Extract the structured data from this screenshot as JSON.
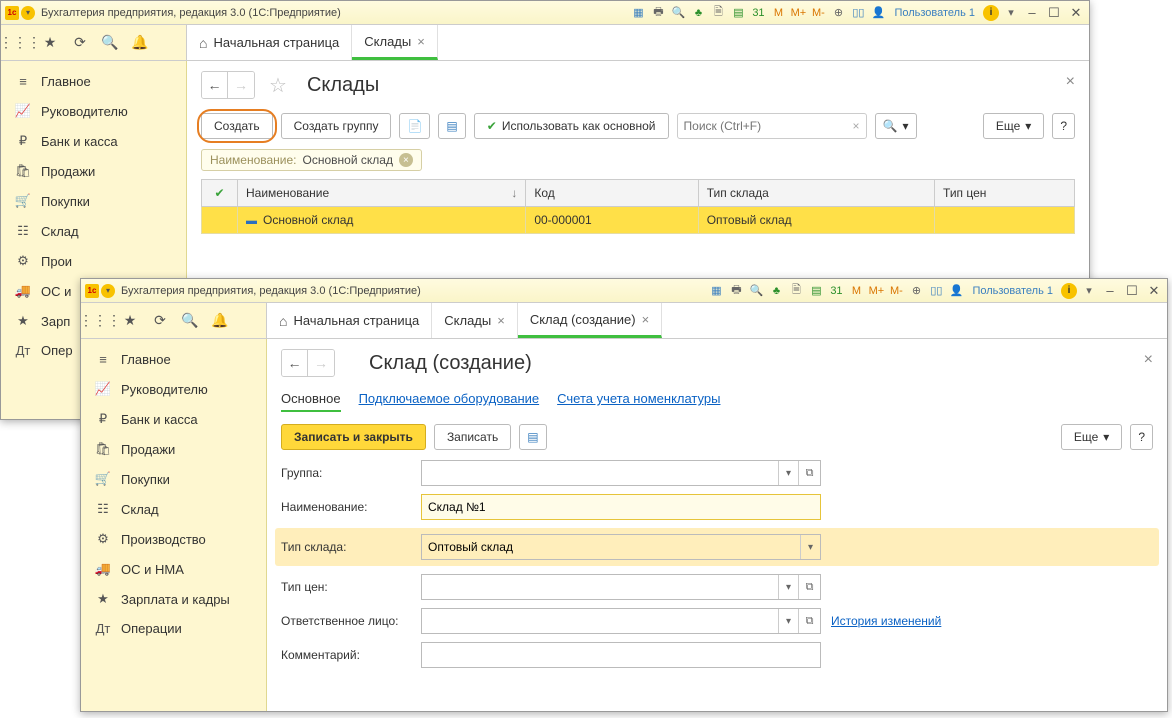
{
  "win1": {
    "title": "Бухгалтерия предприятия, редакция 3.0  (1С:Предприятие)",
    "user": "Пользователь 1",
    "tabs": {
      "home": "Начальная страница",
      "active": "Склады"
    },
    "page_title": "Склады",
    "toolbar": {
      "create": "Создать",
      "create_group": "Создать группу",
      "use_default": "Использовать как основной",
      "search_ph": "Поиск (Ctrl+F)",
      "more": "Еще"
    },
    "filter": {
      "label": "Наименование:",
      "value": "Основной склад"
    },
    "table": {
      "cols": {
        "name": "Наименование",
        "code": "Код",
        "type": "Тип склада",
        "price": "Тип цен"
      },
      "row": {
        "name": "Основной склад",
        "code": "00-000001",
        "type": "Оптовый склад"
      }
    },
    "sidebar": [
      "Главное",
      "Руководителю",
      "Банк и касса",
      "Продажи",
      "Покупки",
      "Склад",
      "Прои",
      "ОС и",
      "Зарп",
      "Опер"
    ]
  },
  "win2": {
    "title": "Бухгалтерия предприятия, редакция 3.0  (1С:Предприятие)",
    "user": "Пользователь 1",
    "tabs": {
      "home": "Начальная страница",
      "t1": "Склады",
      "t2": "Склад (создание)"
    },
    "page_title": "Склад (создание)",
    "subtabs": {
      "main": "Основное",
      "equip": "Подключаемое оборудование",
      "acct": "Счета учета номенклатуры"
    },
    "toolbar": {
      "save_close": "Записать и закрыть",
      "save": "Записать",
      "more": "Еще"
    },
    "form": {
      "group": "Группа:",
      "name": "Наименование:",
      "name_val": "Склад №1",
      "wtype": "Тип склада:",
      "wtype_val": "Оптовый склад",
      "ptype": "Тип цен:",
      "resp": "Ответственное лицо:",
      "history": "История изменений",
      "comment": "Комментарий:"
    },
    "sidebar": [
      "Главное",
      "Руководителю",
      "Банк и касса",
      "Продажи",
      "Покупки",
      "Склад",
      "Производство",
      "ОС и НМА",
      "Зарплата и кадры",
      "Операции"
    ]
  },
  "side_icons": [
    "≡",
    "📈",
    "₽",
    "🛍",
    "🛒",
    "☷",
    "⚙",
    "🚚",
    "★",
    "Дт"
  ]
}
